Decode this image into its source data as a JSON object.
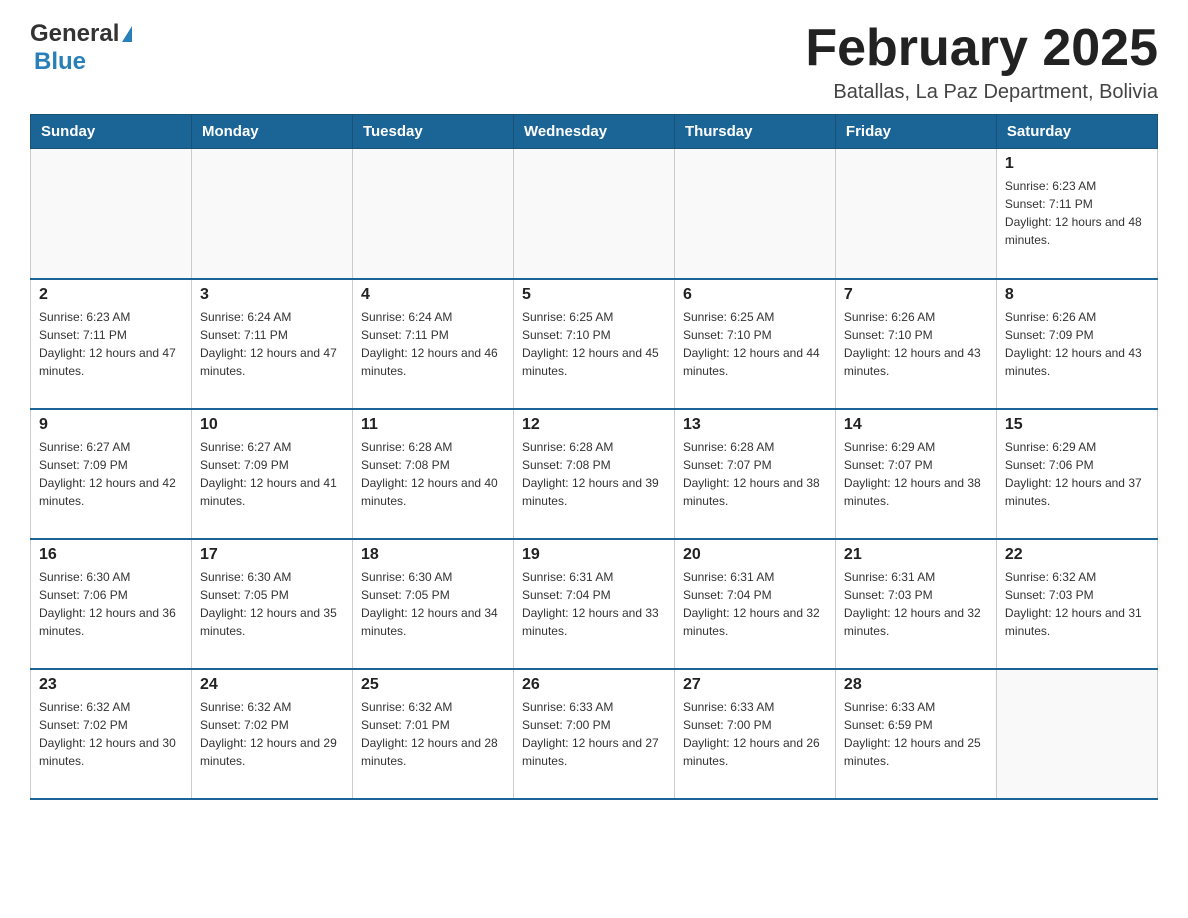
{
  "header": {
    "logo_general": "General",
    "logo_blue": "Blue",
    "month_title": "February 2025",
    "subtitle": "Batallas, La Paz Department, Bolivia"
  },
  "days_of_week": [
    "Sunday",
    "Monday",
    "Tuesday",
    "Wednesday",
    "Thursday",
    "Friday",
    "Saturday"
  ],
  "weeks": [
    {
      "days": [
        {
          "num": "",
          "info": ""
        },
        {
          "num": "",
          "info": ""
        },
        {
          "num": "",
          "info": ""
        },
        {
          "num": "",
          "info": ""
        },
        {
          "num": "",
          "info": ""
        },
        {
          "num": "",
          "info": ""
        },
        {
          "num": "1",
          "info": "Sunrise: 6:23 AM\nSunset: 7:11 PM\nDaylight: 12 hours and 48 minutes."
        }
      ]
    },
    {
      "days": [
        {
          "num": "2",
          "info": "Sunrise: 6:23 AM\nSunset: 7:11 PM\nDaylight: 12 hours and 47 minutes."
        },
        {
          "num": "3",
          "info": "Sunrise: 6:24 AM\nSunset: 7:11 PM\nDaylight: 12 hours and 47 minutes."
        },
        {
          "num": "4",
          "info": "Sunrise: 6:24 AM\nSunset: 7:11 PM\nDaylight: 12 hours and 46 minutes."
        },
        {
          "num": "5",
          "info": "Sunrise: 6:25 AM\nSunset: 7:10 PM\nDaylight: 12 hours and 45 minutes."
        },
        {
          "num": "6",
          "info": "Sunrise: 6:25 AM\nSunset: 7:10 PM\nDaylight: 12 hours and 44 minutes."
        },
        {
          "num": "7",
          "info": "Sunrise: 6:26 AM\nSunset: 7:10 PM\nDaylight: 12 hours and 43 minutes."
        },
        {
          "num": "8",
          "info": "Sunrise: 6:26 AM\nSunset: 7:09 PM\nDaylight: 12 hours and 43 minutes."
        }
      ]
    },
    {
      "days": [
        {
          "num": "9",
          "info": "Sunrise: 6:27 AM\nSunset: 7:09 PM\nDaylight: 12 hours and 42 minutes."
        },
        {
          "num": "10",
          "info": "Sunrise: 6:27 AM\nSunset: 7:09 PM\nDaylight: 12 hours and 41 minutes."
        },
        {
          "num": "11",
          "info": "Sunrise: 6:28 AM\nSunset: 7:08 PM\nDaylight: 12 hours and 40 minutes."
        },
        {
          "num": "12",
          "info": "Sunrise: 6:28 AM\nSunset: 7:08 PM\nDaylight: 12 hours and 39 minutes."
        },
        {
          "num": "13",
          "info": "Sunrise: 6:28 AM\nSunset: 7:07 PM\nDaylight: 12 hours and 38 minutes."
        },
        {
          "num": "14",
          "info": "Sunrise: 6:29 AM\nSunset: 7:07 PM\nDaylight: 12 hours and 38 minutes."
        },
        {
          "num": "15",
          "info": "Sunrise: 6:29 AM\nSunset: 7:06 PM\nDaylight: 12 hours and 37 minutes."
        }
      ]
    },
    {
      "days": [
        {
          "num": "16",
          "info": "Sunrise: 6:30 AM\nSunset: 7:06 PM\nDaylight: 12 hours and 36 minutes."
        },
        {
          "num": "17",
          "info": "Sunrise: 6:30 AM\nSunset: 7:05 PM\nDaylight: 12 hours and 35 minutes."
        },
        {
          "num": "18",
          "info": "Sunrise: 6:30 AM\nSunset: 7:05 PM\nDaylight: 12 hours and 34 minutes."
        },
        {
          "num": "19",
          "info": "Sunrise: 6:31 AM\nSunset: 7:04 PM\nDaylight: 12 hours and 33 minutes."
        },
        {
          "num": "20",
          "info": "Sunrise: 6:31 AM\nSunset: 7:04 PM\nDaylight: 12 hours and 32 minutes."
        },
        {
          "num": "21",
          "info": "Sunrise: 6:31 AM\nSunset: 7:03 PM\nDaylight: 12 hours and 32 minutes."
        },
        {
          "num": "22",
          "info": "Sunrise: 6:32 AM\nSunset: 7:03 PM\nDaylight: 12 hours and 31 minutes."
        }
      ]
    },
    {
      "days": [
        {
          "num": "23",
          "info": "Sunrise: 6:32 AM\nSunset: 7:02 PM\nDaylight: 12 hours and 30 minutes."
        },
        {
          "num": "24",
          "info": "Sunrise: 6:32 AM\nSunset: 7:02 PM\nDaylight: 12 hours and 29 minutes."
        },
        {
          "num": "25",
          "info": "Sunrise: 6:32 AM\nSunset: 7:01 PM\nDaylight: 12 hours and 28 minutes."
        },
        {
          "num": "26",
          "info": "Sunrise: 6:33 AM\nSunset: 7:00 PM\nDaylight: 12 hours and 27 minutes."
        },
        {
          "num": "27",
          "info": "Sunrise: 6:33 AM\nSunset: 7:00 PM\nDaylight: 12 hours and 26 minutes."
        },
        {
          "num": "28",
          "info": "Sunrise: 6:33 AM\nSunset: 6:59 PM\nDaylight: 12 hours and 25 minutes."
        },
        {
          "num": "",
          "info": ""
        }
      ]
    }
  ]
}
